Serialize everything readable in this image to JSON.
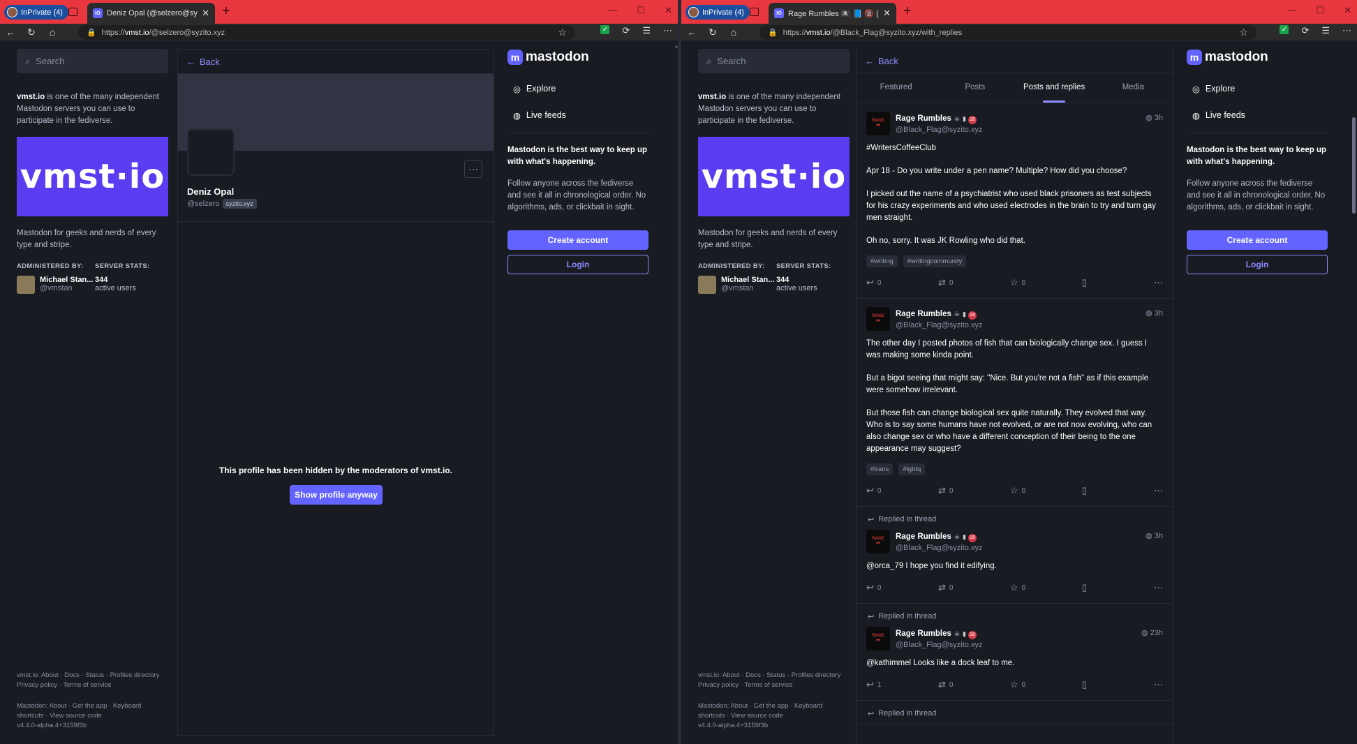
{
  "left": {
    "browser": {
      "private_label": "InPrivate (4)",
      "tab_title": "Deniz Opal (@selzero@syzito.xyz",
      "url_prefix": "https://",
      "url_host": "vmst.io",
      "url_path": "/@selzero@syzito.xyz"
    },
    "search_placeholder": "Search",
    "server": {
      "name": "vmst.io",
      "intro": " is one of the many independent Mastodon servers you can use to participate in the fediverse.",
      "hero": "vmst·io",
      "desc": "Mastodon for geeks and nerds of every type and stripe.",
      "admin_head": "ADMINISTERED BY:",
      "stats_head": "SERVER STATS:",
      "admin_name": "Michael Stan...",
      "admin_handle": "@vmstan",
      "stat_value": "344",
      "stat_label": "active users"
    },
    "footer": {
      "line1": "vmst.io: About · Docs · Status · Profiles directory",
      "line2": "Privacy policy · Terms of service",
      "line3": "Mastodon: About · Get the app · Keyboard",
      "line4": "shortcuts · View source code",
      "line5": "v4.4.0-alpha.4+3159f3b"
    },
    "back": "Back",
    "profile": {
      "name": "Deniz Opal",
      "handle": "@selzero",
      "domain": "syzito.xyz",
      "hidden_msg": "This profile has been hidden by the moderators of vmst.io.",
      "show_btn": "Show profile anyway"
    },
    "right": {
      "logo": "mastodon",
      "explore": "Explore",
      "live": "Live feeds",
      "pitch": "Mastodon is the best way to keep up with what's happening.",
      "pitch2": "Follow anyone across the fediverse and see it all in chronological order. No algorithms, ads, or clickbait in sight.",
      "create": "Create account",
      "login": "Login"
    }
  },
  "right": {
    "browser": {
      "private_label": "InPrivate (4)",
      "tab_title": "Rage Rumbles 🏴‍☠️ 📘 🔞 (@Black_F",
      "url_prefix": "https://",
      "url_host": "vmst.io",
      "url_path": "/@Black_Flag@syzito.xyz/with_replies"
    },
    "tabs": [
      "Featured",
      "Posts",
      "Posts and replies",
      "Media"
    ],
    "posts": [
      {
        "reply": "",
        "name": "Rage Rumbles",
        "handle": "@Black_Flag@syzito.xyz",
        "time": "3h",
        "paras": [
          "#WritersCoffeeClub",
          "Apr 18 - Do you write under a pen name? Multiple? How did you choose?",
          "I picked out the name of a psychiatrist who used black prisoners as test subjects for his crazy experiments and who used electrodes in the brain to try and turn gay men straight.",
          "Oh no, sorry. It was JK Rowling who did that."
        ],
        "tags": [
          "#writing",
          "#writingcommunity"
        ],
        "replies": "0",
        "boosts": "0",
        "favs": "0"
      },
      {
        "reply": "",
        "name": "Rage Rumbles",
        "handle": "@Black_Flag@syzito.xyz",
        "time": "3h",
        "paras": [
          "The other day I posted photos of fish that can biologically change sex. I guess I was making some kinda point.",
          "But a bigot seeing that might say: \"Nice. But you're not a fish\" as if this example were somehow irrelevant.",
          "But those fish can change biological sex quite naturally. They evolved that way. Who is to say some humans have not evolved, or are not now evolving, who can also change sex or who have a different conception of their being to the one appearance may suggest?"
        ],
        "tags": [
          "#trans",
          "#lgbtq"
        ],
        "replies": "0",
        "boosts": "0",
        "favs": "0"
      },
      {
        "reply": "Replied in thread",
        "name": "Rage Rumbles",
        "handle": "@Black_Flag@syzito.xyz",
        "time": "3h",
        "paras": [
          "@orca_79 I hope you find it edifying."
        ],
        "tags": [],
        "replies": "0",
        "boosts": "0",
        "favs": "0"
      },
      {
        "reply": "Replied in thread",
        "name": "Rage Rumbles",
        "handle": "@Black_Flag@syzito.xyz",
        "time": "23h",
        "paras": [
          "@kathimmel Looks like a dock leaf to me."
        ],
        "tags": [],
        "replies": "1",
        "boosts": "0",
        "favs": "0"
      }
    ],
    "last_reply": "Replied in thread"
  },
  "colors": {
    "accent": "#6364ff",
    "link": "#8c8dff",
    "bg": "#191b22",
    "tabbar": "#e8373f"
  },
  "icons": {
    "search": "search-icon",
    "back": "arrow-left-icon",
    "explore": "compass-icon",
    "live": "globe-icon",
    "reply": "reply-icon",
    "boost": "boost-icon",
    "fav": "star-icon",
    "bookmark": "bookmark-icon",
    "more": "ellipsis-icon"
  }
}
